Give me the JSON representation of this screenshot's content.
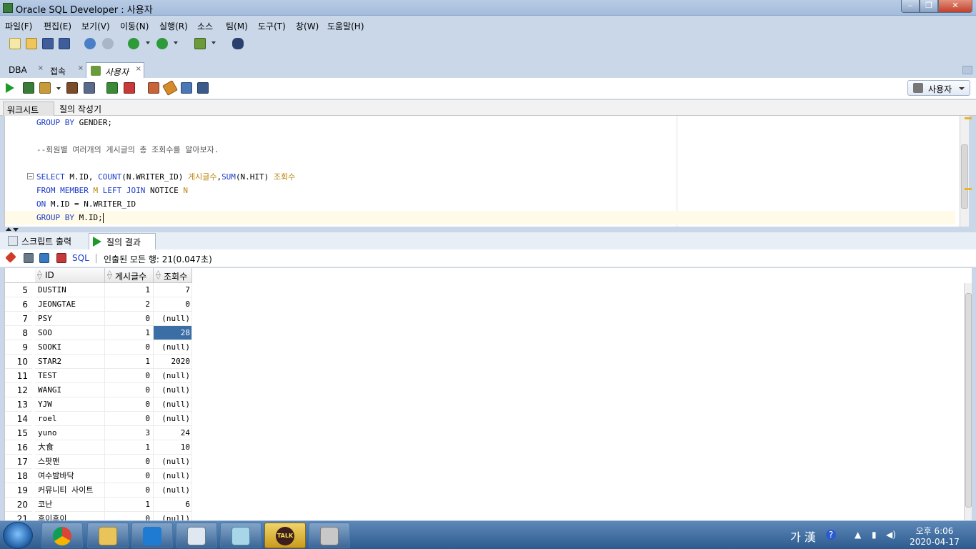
{
  "window": {
    "title": "Oracle SQL Developer : 사용자"
  },
  "menu": [
    "파일(F)",
    "편집(E)",
    "보기(V)",
    "이동(N)",
    "실행(R)",
    "소스",
    "팀(M)",
    "도구(T)",
    "창(W)",
    "도움말(H)"
  ],
  "doc_tabs": [
    {
      "label": "DBA",
      "close": "×"
    },
    {
      "label": "접속",
      "close": "×"
    },
    {
      "label": "사용자",
      "close": "×"
    }
  ],
  "connection": {
    "label": "사용자"
  },
  "sub_tabs": [
    "워크시트",
    "질의 작성기"
  ],
  "editor": {
    "fold_toggle": "−",
    "lines": [
      [
        {
          "t": "GROUP BY ",
          "c": "kw"
        },
        {
          "t": "GENDER;",
          "c": "plain"
        }
      ],
      [],
      [
        {
          "t": "--회원별 여러개의 게시글의 총 조회수를 알아보자.",
          "c": "cm"
        }
      ],
      [],
      [
        {
          "t": "SELECT ",
          "c": "kw"
        },
        {
          "t": "M.ID, ",
          "c": "plain"
        },
        {
          "t": "COUNT",
          "c": "kw"
        },
        {
          "t": "(N.WRITER_ID) ",
          "c": "plain"
        },
        {
          "t": "게시글수",
          "c": "ident"
        },
        {
          "t": ",",
          "c": "plain"
        },
        {
          "t": "SUM",
          "c": "kw"
        },
        {
          "t": "(N.HIT) ",
          "c": "plain"
        },
        {
          "t": "조회수",
          "c": "ident"
        }
      ],
      [
        {
          "t": "FROM MEMBER ",
          "c": "kw"
        },
        {
          "t": "M ",
          "c": "ident"
        },
        {
          "t": "LEFT JOIN ",
          "c": "kw"
        },
        {
          "t": "NOTICE ",
          "c": "plain"
        },
        {
          "t": "N",
          "c": "ident"
        }
      ],
      [
        {
          "t": "ON ",
          "c": "kw"
        },
        {
          "t": "M.ID = N.WRITER_ID",
          "c": "plain"
        }
      ],
      [
        {
          "t": "GROUP BY ",
          "c": "kw"
        },
        {
          "t": "M.ID;",
          "c": "plain"
        }
      ]
    ]
  },
  "result_tabs": [
    {
      "label": "스크립트 출력",
      "close": "×"
    },
    {
      "label": "질의 결과",
      "close": "×"
    }
  ],
  "result_toolbar": {
    "sql_link": "SQL",
    "status": "인출된 모든 행: 21(0.047초)"
  },
  "grid": {
    "columns": [
      "ID",
      "게시글수",
      "조회수"
    ],
    "rows": [
      {
        "n": "5",
        "id": "DUSTIN",
        "cnt": "1",
        "hit": "7"
      },
      {
        "n": "6",
        "id": "JEONGTAE",
        "cnt": "2",
        "hit": "0"
      },
      {
        "n": "7",
        "id": "PSY",
        "cnt": "0",
        "hit": "(null)"
      },
      {
        "n": "8",
        "id": "SOO",
        "cnt": "1",
        "hit": "28",
        "selected": true
      },
      {
        "n": "9",
        "id": "SOOKI",
        "cnt": "0",
        "hit": "(null)"
      },
      {
        "n": "10",
        "id": "STAR2",
        "cnt": "1",
        "hit": "2020"
      },
      {
        "n": "11",
        "id": "TEST",
        "cnt": "0",
        "hit": "(null)"
      },
      {
        "n": "12",
        "id": "WANGI",
        "cnt": "0",
        "hit": "(null)"
      },
      {
        "n": "13",
        "id": "YJW",
        "cnt": "0",
        "hit": "(null)"
      },
      {
        "n": "14",
        "id": "roel",
        "cnt": "0",
        "hit": "(null)"
      },
      {
        "n": "15",
        "id": "yuno",
        "cnt": "3",
        "hit": "24"
      },
      {
        "n": "16",
        "id": "大食",
        "cnt": "1",
        "hit": "10"
      },
      {
        "n": "17",
        "id": "스팟맨",
        "cnt": "0",
        "hit": "(null)"
      },
      {
        "n": "18",
        "id": "여수밤바닥",
        "cnt": "0",
        "hit": "(null)"
      },
      {
        "n": "19",
        "id": "커뮤니티 사이트",
        "cnt": "0",
        "hit": "(null)"
      },
      {
        "n": "20",
        "id": "코난",
        "cnt": "1",
        "hit": "6"
      },
      {
        "n": "21",
        "id": "후이후이",
        "cnt": "0",
        "hit": "(null)"
      }
    ]
  },
  "taskbar": {
    "apps": [
      "chrome-icon",
      "explorer-icon",
      "vscode-icon",
      "sqldeveloper-icon",
      "notepad-icon",
      "kakaotalk-icon",
      "keys-icon"
    ],
    "kakao_label": "TALK",
    "ime": "가 漢",
    "time": "오후 6:06",
    "date": "2020-04-17"
  },
  "colors": {
    "keyword": "#1a3bc7",
    "identifier": "#b8850a",
    "selection": "#3a6ea5"
  }
}
